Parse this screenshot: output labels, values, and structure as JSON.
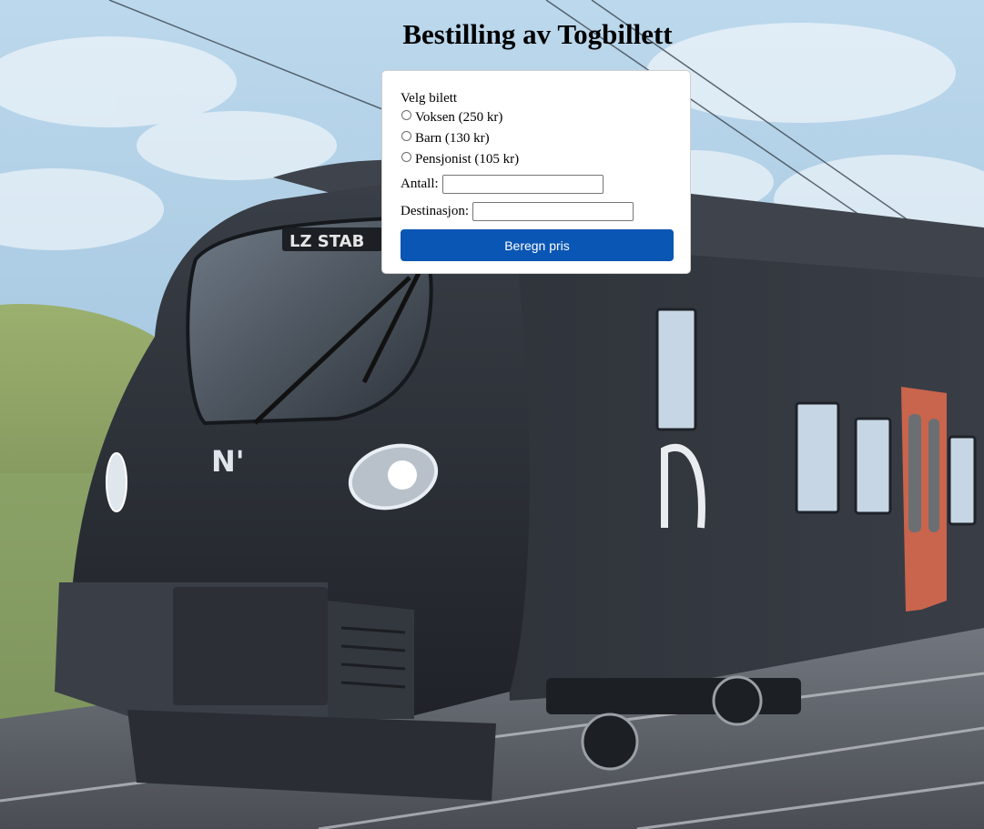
{
  "page": {
    "title": "Bestilling av Togbillett"
  },
  "form": {
    "ticket_label": "Velg bilett",
    "ticket_options": [
      {
        "label": "Voksen (250 kr)",
        "selected": false
      },
      {
        "label": "Barn (130 kr)",
        "selected": false
      },
      {
        "label": "Pensjonist (105 kr)",
        "selected": false
      }
    ],
    "quantity_label": "Antall:",
    "quantity_value": "",
    "destination_label": "Destinasjon:",
    "destination_value": "",
    "submit_label": "Beregn pris"
  },
  "background": {
    "train_logo": "N'",
    "destination_sign": "LZ STAB",
    "colors": {
      "sky": "#a9cbe3",
      "hill": "#8aa060",
      "train_body": "#2b2f36",
      "door_accent": "#c9644d",
      "button": "#0a56b4"
    }
  }
}
